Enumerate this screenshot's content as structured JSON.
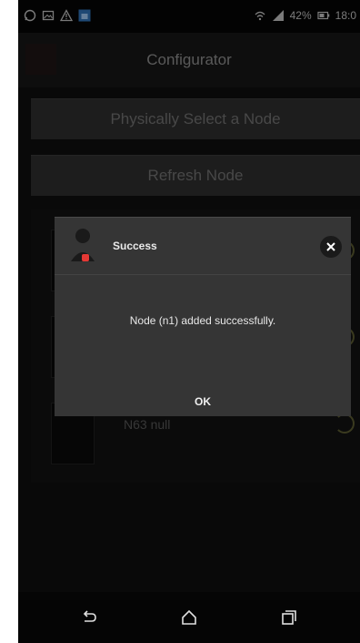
{
  "status_bar": {
    "battery_text": "42%",
    "time_text": "18:0",
    "left_icons": [
      "whatsapp-icon",
      "image-icon",
      "warning-icon",
      "store-icon"
    ],
    "right_icons": [
      "wifi-icon",
      "signal-icon",
      "battery-icon"
    ]
  },
  "app_bar": {
    "title": "Configurator",
    "icon": "app-icon"
  },
  "buttons": {
    "select_node": "Physically Select a Node",
    "refresh_node": "Refresh Node"
  },
  "node_list": {
    "items": [
      {
        "label": ""
      },
      {
        "label": ""
      },
      {
        "label": "N63 null"
      }
    ]
  },
  "dialog": {
    "title": "Success",
    "message": "Node (n1) added successfully.",
    "ok_label": "OK",
    "icons": [
      "user-avatar-icon",
      "close-icon"
    ]
  },
  "nav_bar": {
    "icons": [
      "back-icon",
      "home-icon",
      "recent-apps-icon"
    ]
  },
  "colors": {
    "background": "#0e0e0e",
    "app_bar": "#161616",
    "button": "#2d2d2d",
    "dialog": "#353535",
    "accent_red": "#e53935"
  }
}
